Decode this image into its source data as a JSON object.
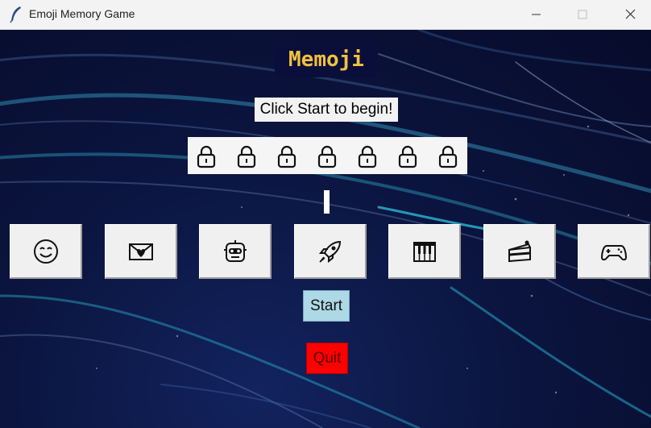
{
  "window": {
    "title": "Emoji Memory Game",
    "controls": [
      "minimize",
      "maximize",
      "close"
    ]
  },
  "game": {
    "heading": "Memoji",
    "status": "Click Start to begin!",
    "locked_slots": 7,
    "emoji_buttons": [
      {
        "icon": "smiling-face-icon"
      },
      {
        "icon": "love-letter-icon"
      },
      {
        "icon": "robot-face-icon"
      },
      {
        "icon": "rocket-icon"
      },
      {
        "icon": "piano-keys-icon"
      },
      {
        "icon": "cake-slice-icon"
      },
      {
        "icon": "game-controller-icon"
      }
    ],
    "start_label": "Start",
    "quit_label": "Quit"
  },
  "colors": {
    "heading_bg": "#0a0e3a",
    "heading_text": "#f2c23e",
    "start_bg": "#add8e6",
    "quit_bg": "#ff0000",
    "background": "#0b1540"
  }
}
